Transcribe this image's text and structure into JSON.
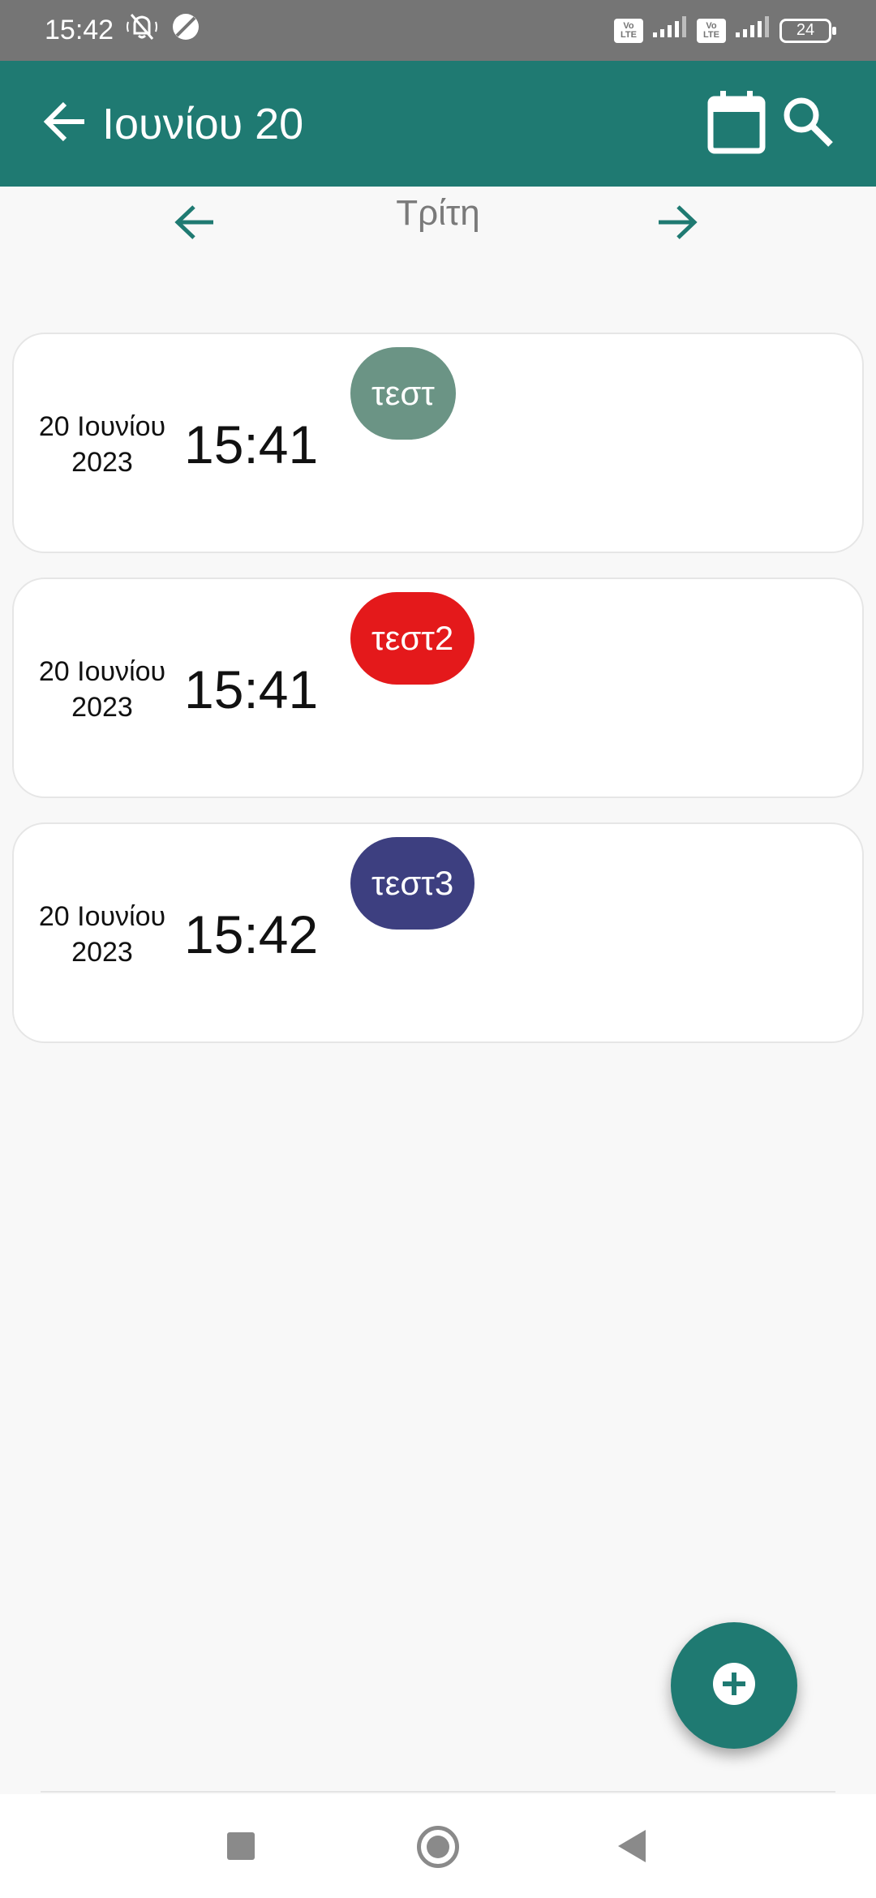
{
  "status_bar": {
    "time": "15:42",
    "lte_top": "Vo",
    "lte_bottom": "LTE",
    "battery": "24"
  },
  "app_bar": {
    "title": "Ιουνίου 20",
    "back_icon": "arrow-back-icon",
    "calendar_icon": "calendar-icon",
    "search_icon": "search-icon"
  },
  "day_nav": {
    "label": "Τρίτη",
    "prev_icon": "arrow-left-icon",
    "next_icon": "arrow-right-icon"
  },
  "entries": [
    {
      "date": "20 Ιουνίου",
      "year": "2023",
      "time": "15:41",
      "tag": "τεστ",
      "color": "#6b9485"
    },
    {
      "date": "20 Ιουνίου",
      "year": "2023",
      "time": "15:41",
      "tag": "τεστ2",
      "color": "#e4191b"
    },
    {
      "date": "20 Ιουνίου",
      "year": "2023",
      "time": "15:42",
      "tag": "τεστ3",
      "color": "#3d3f80"
    }
  ],
  "fab": {
    "icon": "add-circle-icon"
  },
  "colors": {
    "primary": "#1f7a72",
    "status_bar": "#757575",
    "background": "#f8f8f8"
  }
}
